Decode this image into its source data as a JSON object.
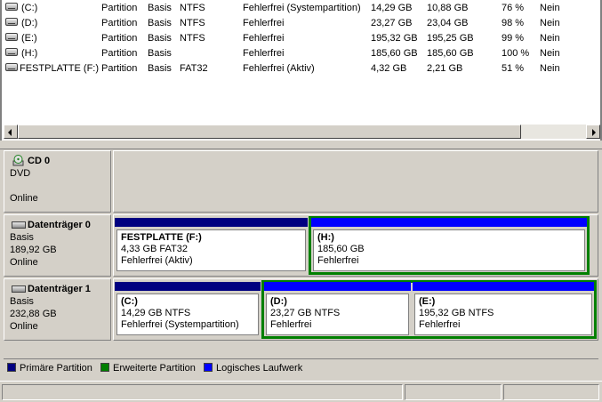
{
  "volumes": [
    {
      "name": "(C:)",
      "layout": "Partition",
      "type": "Basis",
      "fs": "NTFS",
      "status": "Fehlerfrei (Systempartition)",
      "capacity": "14,29 GB",
      "free": "10,88 GB",
      "pct": "76 %",
      "fault_tolerance": "Nein"
    },
    {
      "name": "(D:)",
      "layout": "Partition",
      "type": "Basis",
      "fs": "NTFS",
      "status": "Fehlerfrei",
      "capacity": "23,27 GB",
      "free": "23,04 GB",
      "pct": "98 %",
      "fault_tolerance": "Nein"
    },
    {
      "name": "(E:)",
      "layout": "Partition",
      "type": "Basis",
      "fs": "NTFS",
      "status": "Fehlerfrei",
      "capacity": "195,32 GB",
      "free": "195,25 GB",
      "pct": "99 %",
      "fault_tolerance": "Nein"
    },
    {
      "name": "(H:)",
      "layout": "Partition",
      "type": "Basis",
      "fs": "",
      "status": "Fehlerfrei",
      "capacity": "185,60 GB",
      "free": "185,60 GB",
      "pct": "100 %",
      "fault_tolerance": "Nein"
    },
    {
      "name": "FESTPLATTE (F:)",
      "layout": "Partition",
      "type": "Basis",
      "fs": "FAT32",
      "status": "Fehlerfrei (Aktiv)",
      "capacity": "4,32 GB",
      "free": "2,21 GB",
      "pct": "51 %",
      "fault_tolerance": "Nein"
    }
  ],
  "disks": {
    "cd0": {
      "title": "CD 0",
      "type": "DVD",
      "state": "Online"
    },
    "disk0": {
      "title": "Datenträger 0",
      "type": "Basis",
      "size": "189,92 GB",
      "state": "Online",
      "partitions": [
        {
          "name": "FESTPLATTE  (F:)",
          "size": "4,33 GB FAT32",
          "status": "Fehlerfrei (Aktiv)"
        },
        {
          "name": "(H:)",
          "size": "185,60 GB",
          "status": "Fehlerfrei"
        }
      ]
    },
    "disk1": {
      "title": "Datenträger 1",
      "type": "Basis",
      "size": "232,88 GB",
      "state": "Online",
      "partitions": [
        {
          "name": "(C:)",
          "size": "14,29 GB NTFS",
          "status": "Fehlerfrei (Systempartition)"
        },
        {
          "name": "(D:)",
          "size": "23,27 GB NTFS",
          "status": "Fehlerfrei"
        },
        {
          "name": "(E:)",
          "size": "195,32 GB NTFS",
          "status": "Fehlerfrei"
        }
      ]
    }
  },
  "legend": {
    "primary": {
      "label": "Primäre Partition",
      "color": "#000080"
    },
    "extended": {
      "label": "Erweiterte Partition",
      "color": "#007f00"
    },
    "logical": {
      "label": "Logisches Laufwerk",
      "color": "#0000ff"
    }
  }
}
